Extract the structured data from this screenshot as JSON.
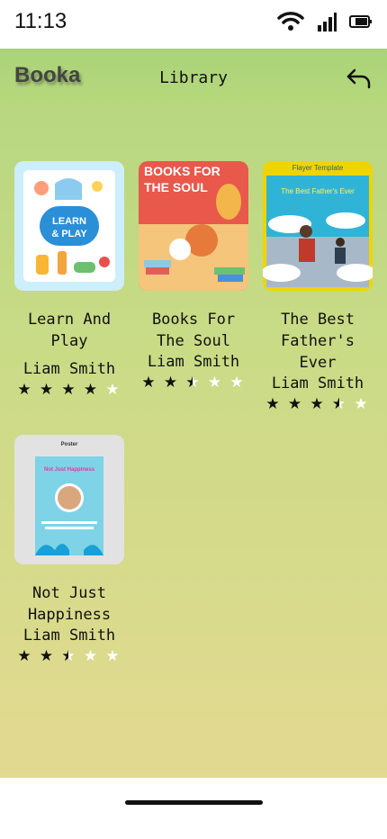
{
  "status": {
    "time": "11:13"
  },
  "header": {
    "brand": "Booka",
    "title": "Library"
  },
  "books": [
    {
      "title": "Learn And Play",
      "author": "Liam Smith",
      "rating": 4,
      "cover_text": [
        "LEARN",
        "& PLAY"
      ]
    },
    {
      "title": "Books For The Soul",
      "author": "Liam Smith",
      "rating": 2.5,
      "cover_text": [
        "BOOKS FOR",
        "THE SOUL"
      ]
    },
    {
      "title": "The Best Father's Ever",
      "author": "Liam Smith",
      "rating": 3.5,
      "cover_text": [
        "Flayer Template",
        "The Best Father's Ever"
      ]
    },
    {
      "title": "Not Just Happiness",
      "author": "Liam Smith",
      "rating": 2.5,
      "cover_text": [
        "Poster",
        "Not Just Happiness"
      ]
    }
  ],
  "colors": {
    "accent": "#b3d67f",
    "star_full": "#111111",
    "star_empty": "#ffffff"
  }
}
